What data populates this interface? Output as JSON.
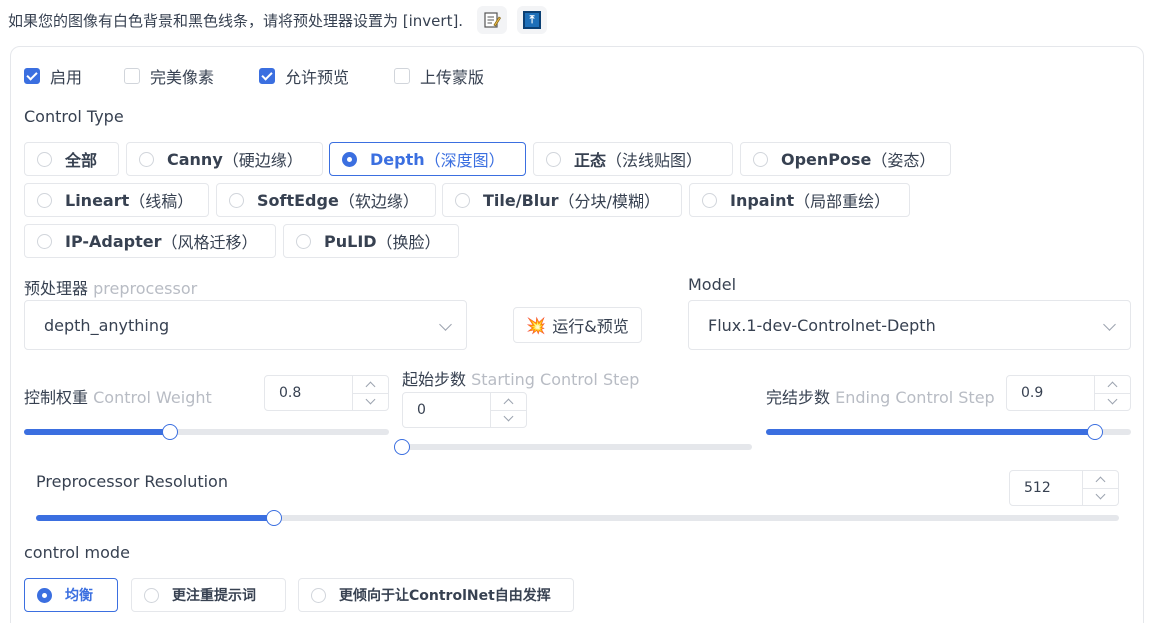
{
  "notice": {
    "text": "如果您的图像有白色背景和黑色线条，请将预处理器设置为 [invert].",
    "btn1_icon": "memo-icon",
    "btn2_icon": "swap-arrows-icon",
    "btn2_glyph": "⤒"
  },
  "checks": [
    {
      "label": "启用",
      "checked": true
    },
    {
      "label": "完美像素",
      "checked": false
    },
    {
      "label": "允许预览",
      "checked": true
    },
    {
      "label": "上传蒙版",
      "checked": false
    }
  ],
  "control_type": {
    "title": "Control Type",
    "options": [
      {
        "main": "全部",
        "sub": ""
      },
      {
        "main": "Canny",
        "sub": "（硬边缘）"
      },
      {
        "main": "Depth",
        "sub": "（深度图）"
      },
      {
        "main": "正态",
        "sub": "（法线贴图）"
      },
      {
        "main": "OpenPose",
        "sub": "（姿态）"
      },
      {
        "main": "Lineart",
        "sub": "（线稿）"
      },
      {
        "main": "SoftEdge",
        "sub": "（软边缘）"
      },
      {
        "main": "Tile/Blur",
        "sub": "（分块/模糊）"
      },
      {
        "main": "Inpaint",
        "sub": "（局部重绘）"
      },
      {
        "main": "IP-Adapter",
        "sub": "（风格迁移）"
      },
      {
        "main": "PuLID",
        "sub": "（换脸）"
      }
    ],
    "selected": "Depth"
  },
  "preprocessor": {
    "label": "预处理器",
    "label_sub": "preprocessor",
    "value": "depth_anything"
  },
  "run_button": {
    "icon": "💥",
    "label": "运行&预览"
  },
  "model": {
    "label": "Model",
    "value": "Flux.1-dev-Controlnet-Depth"
  },
  "control_weight": {
    "label": "控制权重",
    "label_sub": "Control Weight",
    "value": "0.8",
    "fraction": 0.4
  },
  "starting_step": {
    "label": "起始步数",
    "label_sub": "Starting Control Step",
    "value": "0",
    "fraction": 0.0
  },
  "ending_step": {
    "label": "完结步数",
    "label_sub": "Ending Control Step",
    "value": "0.9",
    "fraction": 0.9
  },
  "resolution": {
    "label": "Preprocessor Resolution",
    "value": "512",
    "fraction": 0.22
  },
  "control_mode": {
    "title": "control mode",
    "options": [
      "均衡",
      "更注重提示词",
      "更倾向于让ControlNet自由发挥"
    ],
    "selected": "均衡"
  },
  "colors": {
    "accent": "#3b6fe0",
    "border": "#e5e7eb",
    "muted": "#b8bcc4"
  }
}
